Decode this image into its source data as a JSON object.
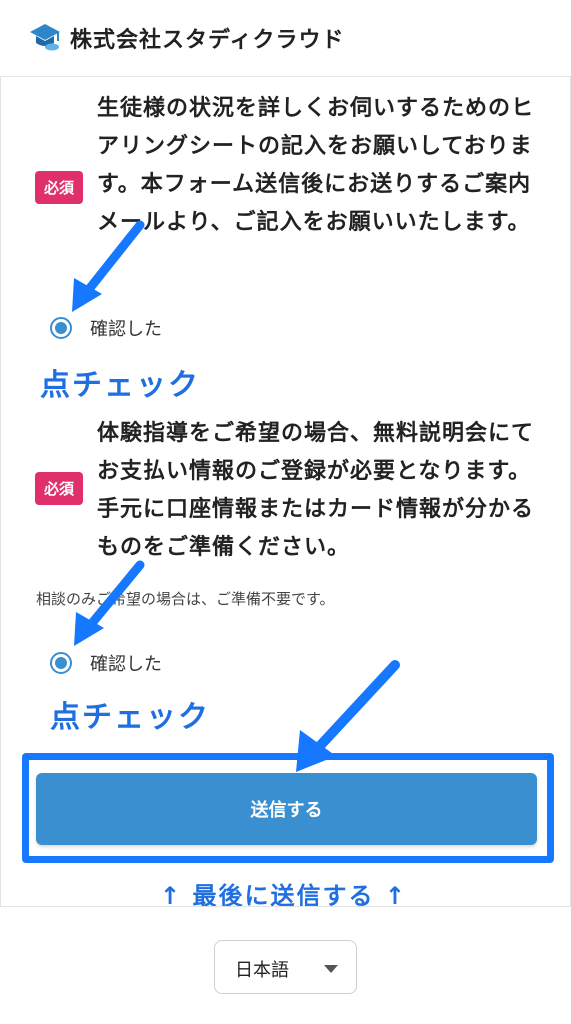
{
  "header": {
    "company_name": "株式会社スタディクラウド",
    "logo_icon": "graduation-cap-cloud-icon"
  },
  "question1": {
    "badge": "必須",
    "text": "生徒様の状況を詳しくお伺いするためのヒアリングシートの記入をお願いしております。本フォーム送信後にお送りするご案内メールより、ご記入をお願いいたします。",
    "radio_label": "確認した",
    "selected": true
  },
  "question2": {
    "badge": "必須",
    "text": "体験指導をご希望の場合、無料説明会にてお支払い情報のご登録が必要となります。手元に口座情報またはカード情報が分かるものをご準備ください。",
    "note": "相談のみご希望の場合は、ご準備不要です。",
    "radio_label": "確認した",
    "selected": true
  },
  "annotations": {
    "check1": "点チェック",
    "check2": "点チェック",
    "submit_hint": "↑ 最後に送信する ↑"
  },
  "submit": {
    "label": "送信する"
  },
  "footer": {
    "language": "日本語"
  },
  "colors": {
    "accent_blue": "#3a8fd0",
    "annotation_blue": "#1677ff",
    "badge_red": "#e0306b"
  }
}
